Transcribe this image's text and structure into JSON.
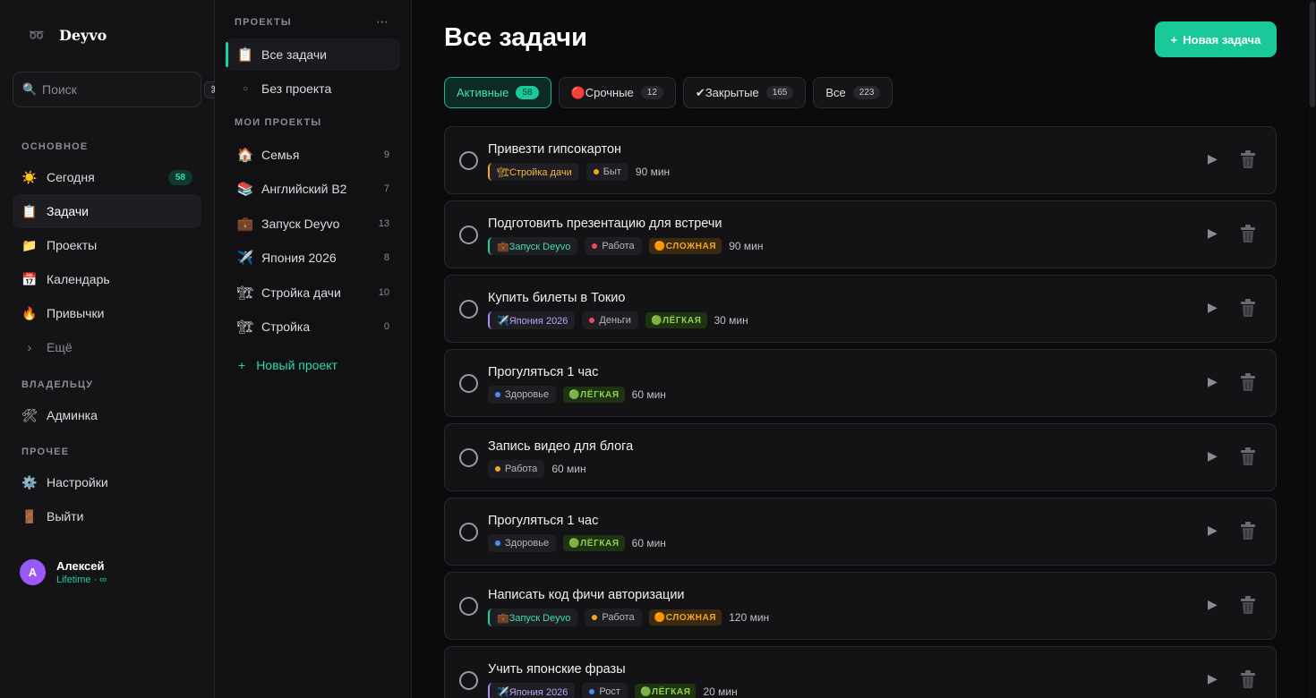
{
  "brand": {
    "name": "Deyvo"
  },
  "search": {
    "placeholder": "Поиск",
    "shortcut": "⌘K"
  },
  "sidebar": {
    "sections": [
      "ОСНОВНОЕ",
      "ВЛАДЕЛЬЦУ",
      "ПРОЧЕЕ"
    ],
    "items": [
      {
        "icon": "sun-icon",
        "glyph": "☀️",
        "label": "Сегодня",
        "badge": "58"
      },
      {
        "icon": "notepad-icon",
        "glyph": "📋",
        "label": "Задачи"
      },
      {
        "icon": "folder-icon",
        "glyph": "📁",
        "label": "Проекты"
      },
      {
        "icon": "calendar-icon",
        "glyph": "📅",
        "label": "Календарь"
      },
      {
        "icon": "fire-icon",
        "glyph": "🔥",
        "label": "Привычки"
      },
      {
        "icon": "chevron-right-icon",
        "glyph": "›",
        "label": "Ещё"
      },
      {
        "icon": "tools-icon",
        "glyph": "🛠",
        "label": "Админка"
      },
      {
        "icon": "gear-icon",
        "glyph": "⚙️",
        "label": "Настройки"
      },
      {
        "icon": "door-icon",
        "glyph": "🚪",
        "label": "Выйти"
      }
    ]
  },
  "user": {
    "initial": "А",
    "name": "Алексей",
    "plan": "Lifetime · ∞"
  },
  "projects": {
    "section_title": "ПРОЕКТЫ",
    "my_title": "МОИ ПРОЕКТЫ",
    "all_label": "Все задачи",
    "no_project_label": "Без проекта",
    "list": [
      {
        "glyph": "🏠",
        "label": "Семья",
        "count": "9"
      },
      {
        "glyph": "📚",
        "label": "Английский B2",
        "count": "7"
      },
      {
        "glyph": "💼",
        "label": "Запуск Deyvo",
        "count": "13"
      },
      {
        "glyph": "✈️",
        "label": "Япония 2026",
        "count": "8"
      },
      {
        "glyph": "🏗",
        "label": "Стройка дачи",
        "count": "10"
      },
      {
        "glyph": "🏗",
        "label": "Стройка",
        "count": "0"
      }
    ],
    "new_label": "Новый проект"
  },
  "main": {
    "title": "Все задачи",
    "new_task_label": "Новая задача",
    "filters": [
      {
        "label": "Активные",
        "count": "58"
      },
      {
        "label": "🔴Срочные",
        "count": "12"
      },
      {
        "label": "✔Закрытые",
        "count": "165"
      },
      {
        "label": "Все",
        "count": "223"
      }
    ]
  },
  "tasks": [
    {
      "title": "Привезти гипсокартон",
      "project": "🏗Стройка дачи",
      "project_color": "#f5a623",
      "tag": "Быт",
      "tag_color": "#f5a623",
      "difficulty": "",
      "duration": "90 мин"
    },
    {
      "title": "Подготовить презентацию для встречи",
      "project": "💼Запуск Deyvo",
      "project_color": "#19d3a2",
      "tag": "Работа",
      "tag_color": "#e84a5f",
      "difficulty": "🟠СЛОЖНАЯ",
      "difficulty_kind": "hard",
      "duration": "90 мин"
    },
    {
      "title": "Купить билеты в Токио",
      "project": "✈️Япония 2026",
      "project_color": "#a78bfa",
      "tag": "Деньги",
      "tag_color": "#e84a5f",
      "difficulty": "🟢ЛЁГКАЯ",
      "difficulty_kind": "easy",
      "duration": "30 мин"
    },
    {
      "title": "Прогуляться 1 час",
      "project": "",
      "tag": "Здоровье",
      "tag_color": "#4c8df5",
      "difficulty": "🟢ЛЁГКАЯ",
      "difficulty_kind": "easy",
      "duration": "60 мин"
    },
    {
      "title": "Запись видео для блога",
      "project": "",
      "tag": "Работа",
      "tag_color": "#f5a623",
      "difficulty": "",
      "duration": "60 мин"
    },
    {
      "title": "Прогуляться 1 час",
      "project": "",
      "tag": "Здоровье",
      "tag_color": "#4c8df5",
      "difficulty": "🟢ЛЁГКАЯ",
      "difficulty_kind": "easy",
      "duration": "60 мин"
    },
    {
      "title": "Написать код фичи авторизации",
      "project": "💼Запуск Deyvo",
      "project_color": "#19d3a2",
      "tag": "Работа",
      "tag_color": "#f5a623",
      "difficulty": "🟠СЛОЖНАЯ",
      "difficulty_kind": "hard",
      "duration": "120 мин"
    },
    {
      "title": "Учить японские фразы",
      "project": "✈️Япония 2026",
      "project_color": "#a78bfa",
      "tag": "Рост",
      "tag_color": "#4c8df5",
      "difficulty": "🟢ЛЁГКАЯ",
      "difficulty_kind": "easy",
      "duration": "20 мин"
    }
  ],
  "colors": {
    "accent": "#19c99a",
    "background": "#0b0b0d"
  }
}
